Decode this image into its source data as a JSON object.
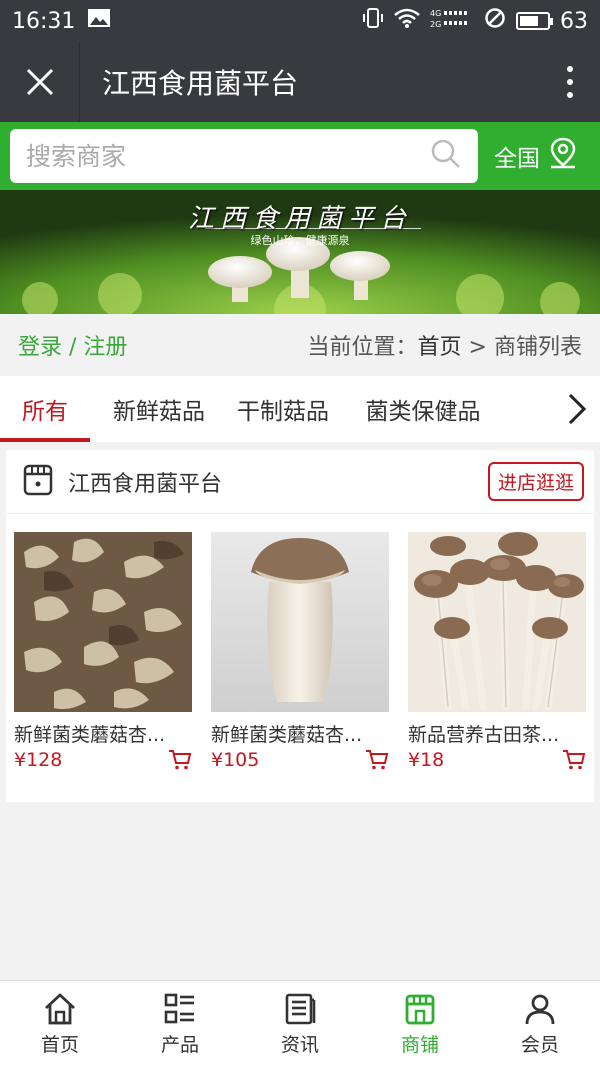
{
  "status_bar": {
    "time": "16:31",
    "battery": "63"
  },
  "title_bar": {
    "title": "江西食用菌平台"
  },
  "search": {
    "placeholder": "搜索商家",
    "region_label": "全国"
  },
  "banner": {
    "title": "江西食用菌平台",
    "subtitle": "绿色山珍，健康源泉"
  },
  "breadcrumb": {
    "login": "登录 / 注册",
    "prefix": "当前位置：",
    "home": "首页",
    "sep": " > ",
    "current": "商铺列表"
  },
  "tabs": [
    {
      "label": "所有",
      "active": true
    },
    {
      "label": "新鲜菇品",
      "active": false
    },
    {
      "label": "干制菇品",
      "active": false
    },
    {
      "label": "菌类保健品",
      "active": false
    }
  ],
  "shop": {
    "name": "江西食用菌平台",
    "enter_label": "进店逛逛",
    "products": [
      {
        "name": "新鲜菌类蘑菇杏...",
        "price": "¥128"
      },
      {
        "name": "新鲜菌类蘑菇杏...",
        "price": "¥105"
      },
      {
        "name": "新品营养古田茶...",
        "price": "¥18"
      }
    ]
  },
  "bottom_nav": [
    {
      "label": "首页",
      "icon": "home-icon",
      "active": false
    },
    {
      "label": "产品",
      "icon": "product-list-icon",
      "active": false
    },
    {
      "label": "资讯",
      "icon": "news-icon",
      "active": false
    },
    {
      "label": "商铺",
      "icon": "store-icon",
      "active": true
    },
    {
      "label": "会员",
      "icon": "user-icon",
      "active": false
    }
  ],
  "colors": {
    "accent_green": "#2fae2f",
    "accent_red": "#c3181f",
    "dark_bar": "#393a3f"
  }
}
